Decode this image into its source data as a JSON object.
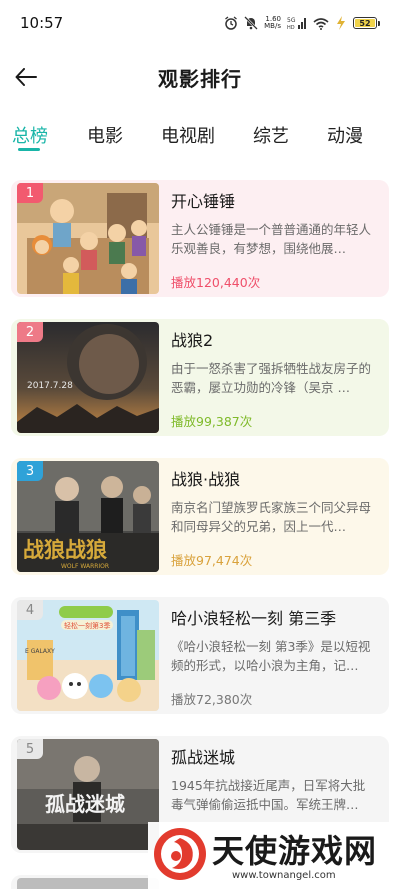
{
  "status": {
    "time": "10:57",
    "net_speed_value": "1.60",
    "net_speed_unit": "MB/s",
    "network_type": "5G HD",
    "battery": "52"
  },
  "nav": {
    "title": "观影排行"
  },
  "tabs": [
    {
      "label": "总榜",
      "active": true
    },
    {
      "label": "电影",
      "active": false
    },
    {
      "label": "电视剧",
      "active": false
    },
    {
      "label": "综艺",
      "active": false
    },
    {
      "label": "动漫",
      "active": false
    }
  ],
  "items": [
    {
      "rank": "1",
      "title": "开心锤锤",
      "desc": "主人公锤锤是一个普普通通的年轻人乐观善良，有梦想，围绕他展…",
      "plays": "播放120,440次"
    },
    {
      "rank": "2",
      "title": "战狼2",
      "desc": "由于一怒杀害了强拆牺牲战友房子的恶霸，屡立功勋的冷锋（吴京 …",
      "plays": "播放99,387次",
      "poster_text": "2017.7.28"
    },
    {
      "rank": "3",
      "title": "战狼·战狼",
      "desc": "南京名门望族罗氏家族三个同父异母和同母异父的兄弟，因上一代…",
      "plays": "播放97,474次",
      "poster_text": "战狼战狼",
      "poster_subtext": "WOLF WARRIOR"
    },
    {
      "rank": "4",
      "title": "哈小浪轻松一刻 第三季",
      "desc": "《哈小浪轻松一刻 第3季》是以短视频的形式，以哈小浪为主角，记…",
      "plays": "播放72,380次",
      "poster_text": "轻松一刻第3季",
      "poster_subtext": "E GALAXY"
    },
    {
      "rank": "5",
      "title": "孤战迷城",
      "desc": "1945年抗战接近尾声，日军将大批毒气弹偷偷运抵中国。军统王牌…",
      "poster_text": "孤战迷城"
    }
  ],
  "watermark": {
    "text": "天使游戏网",
    "url": "www.townangel.com"
  },
  "colors": {
    "accent": "#19b5a8"
  }
}
